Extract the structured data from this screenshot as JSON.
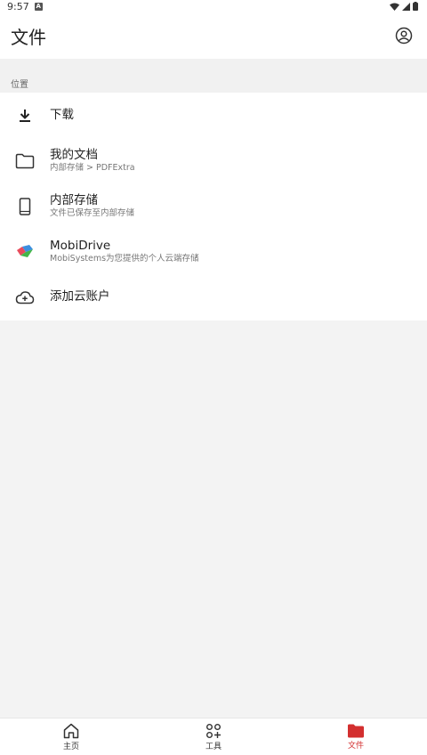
{
  "status_bar": {
    "time": "9:57",
    "notification_letter": "A"
  },
  "app_bar": {
    "title": "文件",
    "account_icon": "account-circle-icon"
  },
  "section": {
    "label": "位置"
  },
  "locations": [
    {
      "icon": "download-icon",
      "title": "下载",
      "subtitle": ""
    },
    {
      "icon": "folder-icon",
      "title": "我的文档",
      "subtitle": "内部存储 > PDFExtra"
    },
    {
      "icon": "phone-icon",
      "title": "内部存储",
      "subtitle": "文件已保存至内部存储"
    },
    {
      "icon": "mobidrive-icon",
      "title": "MobiDrive",
      "subtitle": "MobiSystems为您提供的个人云端存储"
    },
    {
      "icon": "cloud-add-icon",
      "title": "添加云账户",
      "subtitle": ""
    }
  ],
  "bottom_nav": {
    "items": [
      {
        "icon": "home-icon",
        "label": "主页",
        "active": false
      },
      {
        "icon": "tools-icon",
        "label": "工具",
        "active": false
      },
      {
        "icon": "folder-filled-icon",
        "label": "文件",
        "active": true
      }
    ],
    "active_color": "#d32f2f"
  }
}
